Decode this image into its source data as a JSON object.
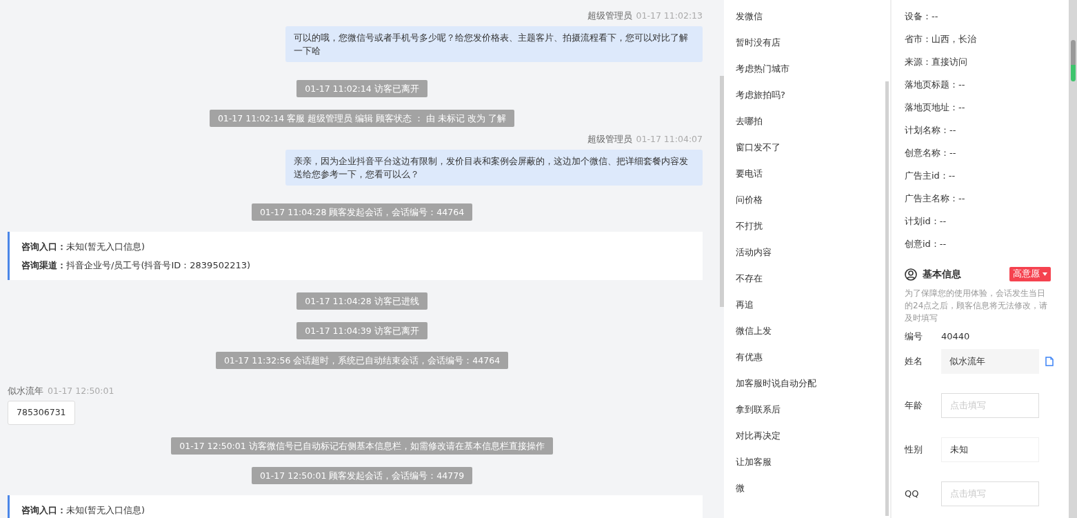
{
  "messages": [
    {
      "kind": "agent",
      "sender": "超级管理员",
      "time": "01-17 11:02:13",
      "text": "可以的哦，您微信号或者手机号多少呢？给您发价格表、主题客片、拍摄流程看下，您可以对比了解一下哈"
    },
    {
      "kind": "system",
      "text": "01-17 11:02:14 访客已离开"
    },
    {
      "kind": "system",
      "text": "01-17 11:02:14 客服 超级管理员 编辑 顾客状态 ： 由 未标记 改为 了解"
    },
    {
      "kind": "agent",
      "sender": "超级管理员",
      "time": "01-17 11:04:07",
      "text": "亲亲，因为企业抖音平台这边有限制，发价目表和案例会屏蔽的，这边加个微信、把详细套餐内容发送给您参考一下，您看可以么？"
    },
    {
      "kind": "system",
      "text": "01-17 11:04:28 顾客发起会话，会话编号：44764"
    },
    {
      "kind": "consult",
      "lines": [
        {
          "label": "咨询入口：",
          "value": "未知(暂无入口信息)"
        },
        {
          "label": "咨询渠道：",
          "value": "抖音企业号/员工号(抖音号ID：2839502213)"
        }
      ]
    },
    {
      "kind": "system",
      "text": "01-17 11:04:28 访客已进线"
    },
    {
      "kind": "system",
      "text": "01-17 11:04:39 访客已离开"
    },
    {
      "kind": "system",
      "text": "01-17 11:32:56 会话超时，系统已自动结束会话，会话编号：44764"
    },
    {
      "kind": "visitor",
      "sender": "似水流年",
      "time": "01-17 12:50:01",
      "text": "785306731"
    },
    {
      "kind": "system",
      "text": "01-17 12:50:01 访客微信号已自动标记右侧基本信息栏，如需修改请在基本信息栏直接操作"
    },
    {
      "kind": "system",
      "text": "01-17 12:50:01 顾客发起会话，会话编号：44779"
    },
    {
      "kind": "consult",
      "lines": [
        {
          "label": "咨询入口：",
          "value": "未知(暂无入口信息)"
        }
      ]
    }
  ],
  "quick_replies": [
    "发微信",
    "暂时没有店",
    "考虑热门城市",
    "考虑旅拍吗?",
    "去哪拍",
    "窗口发不了",
    "要电话",
    "问价格",
    "不打扰",
    "活动内容",
    "不存在",
    "再追",
    "微信上发",
    "有优惠",
    "加客服时说自动分配",
    "拿到联系后",
    "对比再决定",
    "让加客服",
    "微"
  ],
  "visitor_info": [
    "设备：--",
    "省市：山西，长治",
    "来源：直接访问",
    "落地页标题：--",
    "落地页地址：--",
    "计划名称：--",
    "创意名称：--",
    "广告主id：--",
    "广告主名称：--",
    "计划id：--",
    "创意id：--"
  ],
  "basic_info": {
    "title": "基本信息",
    "intent_tag": "高意愿",
    "notice": "为了保障您的使用体验，会话发生当日的24点之后，顾客信息将无法修改，请及时填写",
    "fields": [
      {
        "kind": "text",
        "label": "编号",
        "value": "40440"
      },
      {
        "kind": "filled",
        "label": "姓名",
        "value": "似水流年"
      },
      {
        "kind": "input",
        "label": "年龄",
        "placeholder": "点击填写"
      },
      {
        "kind": "select",
        "label": "性别",
        "value": "未知"
      },
      {
        "kind": "input",
        "label": "QQ",
        "placeholder": "点击填写"
      }
    ]
  }
}
